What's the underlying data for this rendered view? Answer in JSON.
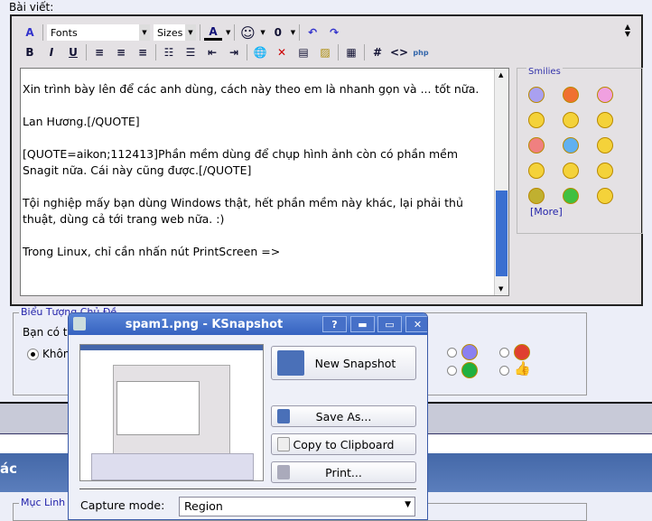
{
  "post_label": "Bài viết:",
  "toolbar": {
    "fonts": "Fonts",
    "sizes": "Sizes",
    "bold": "B",
    "italic": "I",
    "underline": "U",
    "hash": "#",
    "code": "<>"
  },
  "message": [
    "Xin trình bày lên để các anh dùng, cách này theo em là nhanh gọn và ... tốt nữa.",
    "Lan Hương.[/QUOTE]",
    "[QUOTE=aikon;112413]Phần mềm dùng để chụp hình ảnh còn có phần mềm Snagit nữa. Cái này cũng được.[/QUOTE]",
    "",
    "Tội nghiệp mấy bạn dùng Windows thật, hết phần mềm này khác, lại phải thủ thuật, dùng cả tới trang web nữa. :)",
    "Trong Linux, chỉ cần nhấn nút PrintScreen =>"
  ],
  "smilies": {
    "title": "Smilies",
    "more": "[More]"
  },
  "icons_section": {
    "title": "Biểu Tượng Chủ Đề",
    "prompt": "Bạn có t",
    "none_option": "Khôn"
  },
  "section_header": "ác",
  "links_section": {
    "title": "Mục Linh T"
  },
  "ksnapshot": {
    "title": "spam1.png - KSnapshot",
    "help": "?",
    "new_snapshot": "New Snapshot",
    "save_as": "Save As...",
    "copy": "Copy to Clipboard",
    "print": "Print...",
    "capture_mode_label": "Capture mode:",
    "capture_mode": "Region"
  }
}
